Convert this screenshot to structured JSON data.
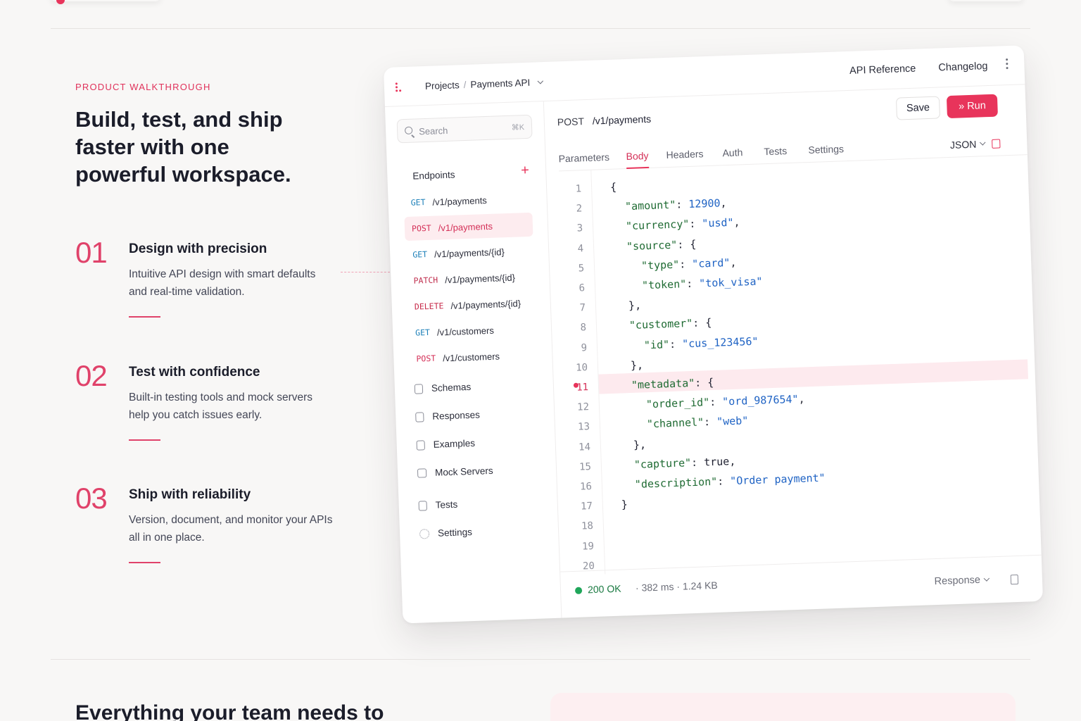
{
  "hero": {
    "eyebrow": "PRODUCT WALKTHROUGH",
    "headline": "Build, test, and ship faster with one powerful workspace."
  },
  "features": [
    {
      "num": "01",
      "title": "Design with precision",
      "desc": "Intuitive API design with smart defaults and real-time validation."
    },
    {
      "num": "02",
      "title": "Test with confidence",
      "desc": "Built-in testing tools and mock servers help you catch issues early."
    },
    {
      "num": "03",
      "title": "Ship with reliability",
      "desc": "Version, document, and monitor your APIs all in one place."
    }
  ],
  "app": {
    "breadcrumb": {
      "root": "Projects",
      "sep": "/",
      "current": "Payments API"
    },
    "toplinks": [
      "API Reference",
      "Changelog"
    ],
    "search": {
      "placeholder": "Search",
      "shortcut": "⌘K"
    },
    "endpoints_title": "Endpoints",
    "endpoints": [
      {
        "method": "GET",
        "path": "/v1/payments"
      },
      {
        "method": "POST",
        "path": "/v1/payments"
      },
      {
        "method": "GET",
        "path": "/v1/payments/{id}"
      },
      {
        "method": "PATCH",
        "path": "/v1/payments/{id}"
      },
      {
        "method": "DELETE",
        "path": "/v1/payments/{id}"
      },
      {
        "method": "GET",
        "path": "/v1/customers"
      },
      {
        "method": "POST",
        "path": "/v1/customers"
      }
    ],
    "nav": [
      "Schemas",
      "Responses",
      "Examples",
      "Mock Servers",
      "Tests",
      "Settings"
    ],
    "request": {
      "method": "POST",
      "path": "/v1/payments"
    },
    "buttons": {
      "save": "Save",
      "run": "Run"
    },
    "tabs": [
      "Parameters",
      "Body",
      "Headers",
      "Auth",
      "Tests",
      "Settings"
    ],
    "active_tab": "Body",
    "format": "JSON",
    "line_numbers": [
      "1",
      "2",
      "3",
      "4",
      "5",
      "6",
      "7",
      "8",
      "9",
      "10",
      "11",
      "12",
      "13",
      "14",
      "15",
      "16",
      "17",
      "18",
      "19",
      "20"
    ],
    "code": [
      {
        "indent": 0,
        "key": "",
        "value": "{",
        "vtype": "b"
      },
      {
        "indent": 1,
        "key": "\"amount\"",
        "value": "12900",
        "vtype": "n",
        "comma": true
      },
      {
        "indent": 1,
        "key": "\"currency\"",
        "value": "\"usd\"",
        "vtype": "s",
        "comma": true
      },
      {
        "indent": 1,
        "key": "\"source\"",
        "value": "{",
        "vtype": "b"
      },
      {
        "indent": 2,
        "key": "\"type\"",
        "value": "\"card\"",
        "vtype": "s",
        "comma": true
      },
      {
        "indent": 2,
        "key": "\"token\"",
        "value": "\"tok_visa\"",
        "vtype": "s"
      },
      {
        "indent": 1,
        "key": "",
        "value": "},",
        "vtype": "b"
      },
      {
        "indent": 1,
        "key": "\"customer\"",
        "value": "{",
        "vtype": "b"
      },
      {
        "indent": 2,
        "key": "\"id\"",
        "value": "\"cus_123456\"",
        "vtype": "s"
      },
      {
        "indent": 1,
        "key": "",
        "value": "},",
        "vtype": "b"
      },
      {
        "indent": 1,
        "key": "\"metadata\"",
        "value": "{",
        "vtype": "b"
      },
      {
        "indent": 2,
        "key": "\"order_id\"",
        "value": "\"ord_987654\"",
        "vtype": "s",
        "comma": true
      },
      {
        "indent": 2,
        "key": "\"channel\"",
        "value": "\"web\"",
        "vtype": "s"
      },
      {
        "indent": 1,
        "key": "",
        "value": "},",
        "vtype": "b"
      },
      {
        "indent": 1,
        "key": "\"capture\"",
        "value": "true",
        "vtype": "b",
        "comma": true
      },
      {
        "indent": 1,
        "key": "\"description\"",
        "value": "\"Order payment\"",
        "vtype": "s"
      },
      {
        "indent": 0,
        "key": "",
        "value": "}",
        "vtype": "b"
      }
    ],
    "highlight_line": "11",
    "footer": {
      "status": "200 OK",
      "time": "382 ms",
      "size": "1.24 KB",
      "response_label": "Response"
    }
  },
  "below": {
    "headline": "Everything your team needs to"
  },
  "colors": {
    "accent": "#e8345b",
    "success": "#1fa65a",
    "string": "#1f63c4",
    "key": "#1f6b33"
  }
}
